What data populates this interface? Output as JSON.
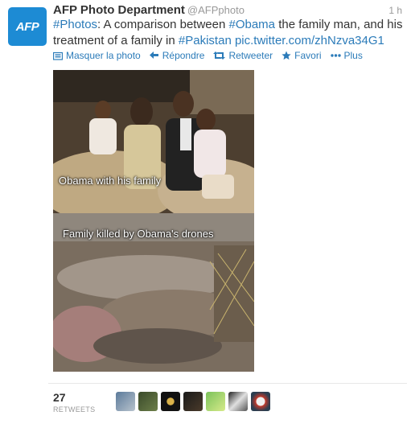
{
  "account": {
    "avatar_text": "AFP",
    "name": "AFP Photo Department",
    "handle": "@AFPphoto",
    "time": "1 h"
  },
  "tweet": {
    "hashtag_photos": "#Photos",
    "text_1": ": A comparison between ",
    "hashtag_obama": "#Obama",
    "text_2": " the family man, and his treatment of a family in ",
    "hashtag_pakistan": "#Pakistan",
    "text_3": " ",
    "link": "pic.twitter.com/zhNzva34G1"
  },
  "actions": {
    "hide_photo": "Masquer la photo",
    "reply": "Répondre",
    "retweet": "Retweeter",
    "favorite": "Favori",
    "more": "Plus"
  },
  "photo": {
    "caption_top": "Obama with his family",
    "caption_bottom": "Family killed by Obama's drones"
  },
  "stats": {
    "retweet_count": "27",
    "retweet_label": "RETWEETS"
  },
  "colors": {
    "link": "#2b7bb9",
    "avatar_bg": "#1d8bd4"
  }
}
